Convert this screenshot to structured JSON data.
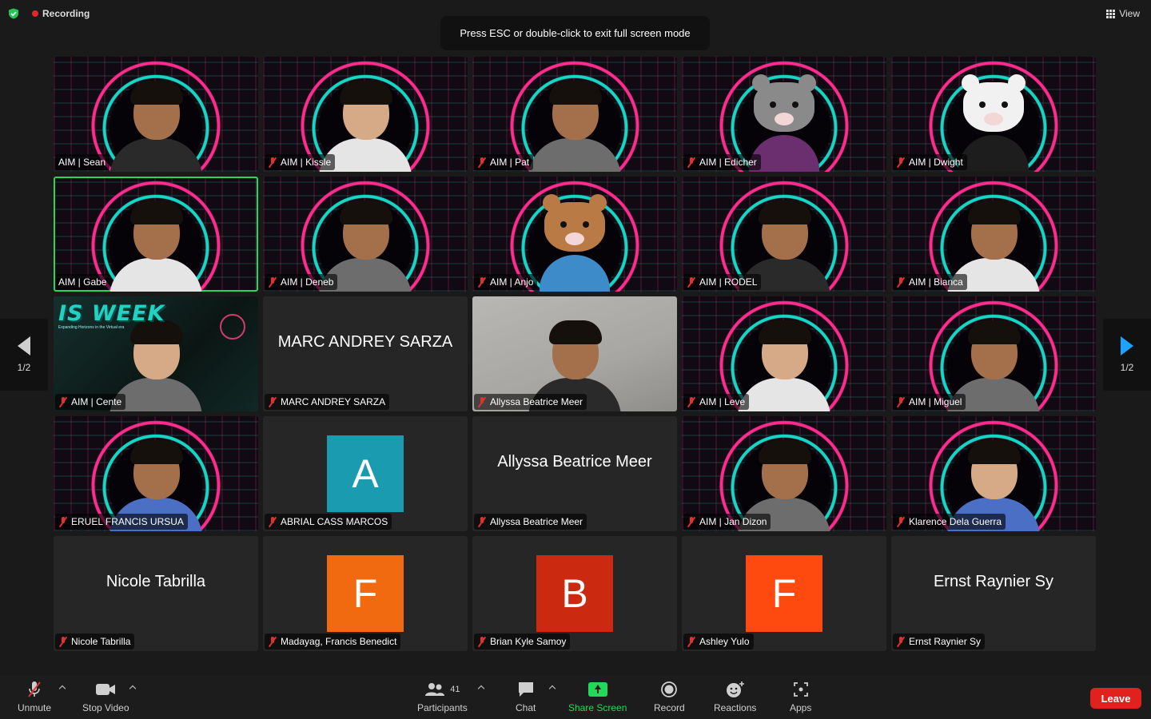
{
  "top": {
    "recording_label": "Recording",
    "view_label": "View",
    "banner": "Press ESC or double-click to exit full screen mode"
  },
  "nav": {
    "left_page": "1/2",
    "right_page": "1/2"
  },
  "tiles": [
    {
      "name": "AIM | Sean",
      "muted": false,
      "bg": "cyber",
      "kind": "person"
    },
    {
      "name": "AIM | Kissle",
      "muted": true,
      "bg": "cyber",
      "kind": "person"
    },
    {
      "name": "AIM | Pat",
      "muted": true,
      "bg": "cyber",
      "kind": "person"
    },
    {
      "name": "AIM | Edicher",
      "muted": true,
      "bg": "cyber",
      "kind": "raccoon"
    },
    {
      "name": "AIM | Dwight",
      "muted": true,
      "bg": "cyber",
      "kind": "bear"
    },
    {
      "name": "AIM | Gabe",
      "muted": false,
      "bg": "cyber",
      "kind": "person",
      "active": true
    },
    {
      "name": "AIM | Deneb",
      "muted": true,
      "bg": "cyber",
      "kind": "person"
    },
    {
      "name": "AIM | Anjo",
      "muted": true,
      "bg": "cyber",
      "kind": "beaver"
    },
    {
      "name": "AIM | RODEL",
      "muted": true,
      "bg": "cyber",
      "kind": "person"
    },
    {
      "name": "AIM | Bianca",
      "muted": true,
      "bg": "cyber",
      "kind": "person"
    },
    {
      "name": "AIM | Cente",
      "muted": true,
      "bg": "isweek",
      "kind": "person",
      "logo": "IS WEEK",
      "logo_sub": "Expanding Horizons in the Virtual era"
    },
    {
      "name": "MARC ANDREY SARZA",
      "muted": true,
      "bg": "plain",
      "kind": "name",
      "center": "MARC ANDREY SARZA"
    },
    {
      "name": "Allyssa Beatrice Meer",
      "muted": true,
      "bg": "video",
      "kind": "person"
    },
    {
      "name": "AIM | Leve",
      "muted": true,
      "bg": "cyber",
      "kind": "person"
    },
    {
      "name": "AIM | Miguel",
      "muted": true,
      "bg": "cyber",
      "kind": "person"
    },
    {
      "name": "ERUEL FRANCIS URSUA",
      "muted": true,
      "bg": "cyber",
      "kind": "person"
    },
    {
      "name": "ABRIAL CASS MARCOS",
      "muted": true,
      "bg": "plain",
      "kind": "initial",
      "initial": "A",
      "color": "#1a9bb0"
    },
    {
      "name": "Allyssa Beatrice Meer",
      "muted": true,
      "bg": "plain",
      "kind": "name",
      "center": "Allyssa Beatrice Meer"
    },
    {
      "name": "AIM | Jan Dizon",
      "muted": true,
      "bg": "cyber",
      "kind": "person"
    },
    {
      "name": "Klarence Dela Guerra",
      "muted": true,
      "bg": "cyber",
      "kind": "person"
    },
    {
      "name": "Nicole Tabrilla",
      "muted": true,
      "bg": "plain",
      "kind": "name",
      "center": "Nicole Tabrilla"
    },
    {
      "name": "Madayag, Francis Benedict",
      "muted": true,
      "bg": "plain",
      "kind": "initial",
      "initial": "F",
      "color": "#f26a0f"
    },
    {
      "name": "Brian Kyle Samoy",
      "muted": true,
      "bg": "plain",
      "kind": "initial",
      "initial": "B",
      "color": "#cc2a10"
    },
    {
      "name": "Ashley Yulo",
      "muted": true,
      "bg": "plain",
      "kind": "initial",
      "initial": "F",
      "color": "#ff4a0f"
    },
    {
      "name": "Ernst Raynier Sy",
      "muted": true,
      "bg": "plain",
      "kind": "name",
      "center": "Ernst Raynier Sy"
    }
  ],
  "toolbar": {
    "unmute": "Unmute",
    "stop_video": "Stop Video",
    "participants": "Participants",
    "participants_count": "41",
    "chat": "Chat",
    "share_screen": "Share Screen",
    "record": "Record",
    "reactions": "Reactions",
    "apps": "Apps",
    "leave": "Leave"
  },
  "colors": {
    "accent_green": "#23d95a",
    "leave_red": "#e0211d",
    "nav_blue": "#1aa3ff"
  }
}
